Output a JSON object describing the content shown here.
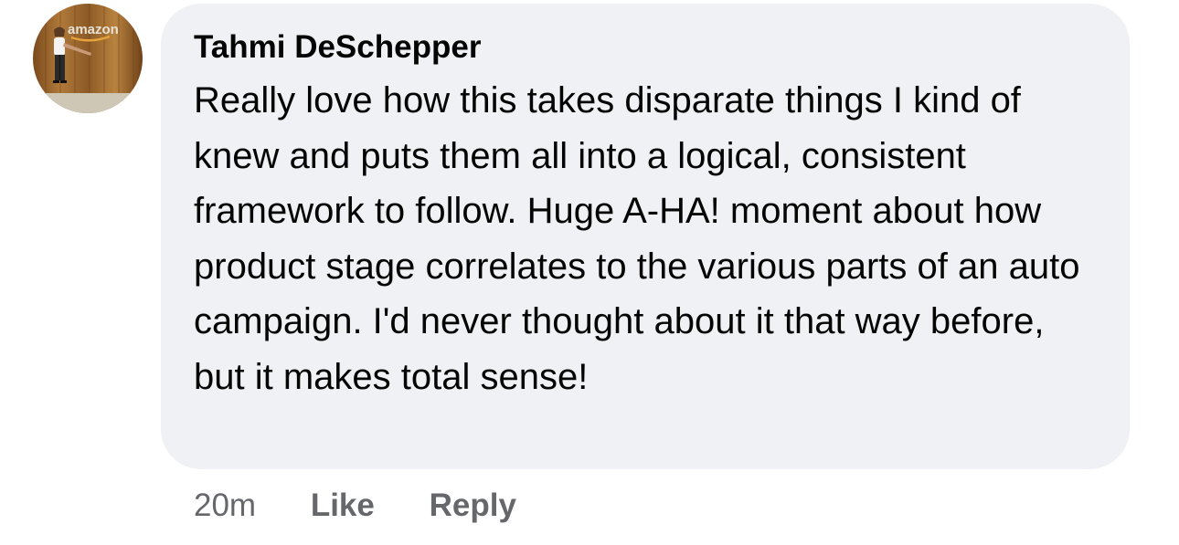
{
  "comment": {
    "author": "Tahmi DeSchepper",
    "avatar_logo_text": "amazon",
    "text": "Really love how this takes disparate things I kind of knew and puts them all into a logical, consistent framework to follow. Huge A-HA! moment about how product stage correlates to the various parts of an auto campaign. I'd never thought about it that way before, but it makes total sense!",
    "timestamp": "20m",
    "like_label": "Like",
    "reply_label": "Reply"
  }
}
